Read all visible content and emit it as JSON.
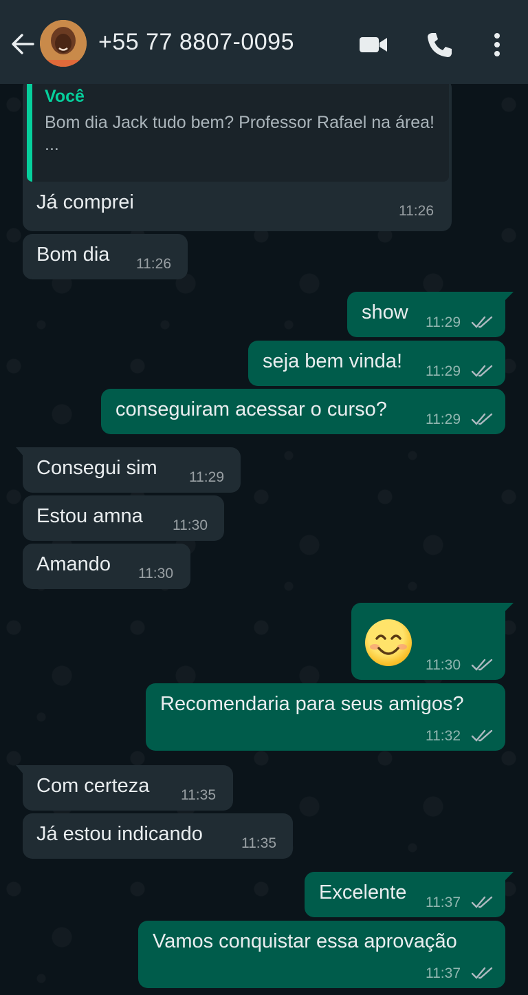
{
  "header": {
    "contact_name": "+55 77 8807-0095",
    "icons": [
      "back-arrow-icon",
      "video-call-icon",
      "phone-icon",
      "more-options-icon"
    ]
  },
  "messages": [
    {
      "side": "in",
      "quote_author": "Você",
      "quote_text": "Bom dia Jack tudo bem? Professor Rafael na área!",
      "quote_more": "...",
      "text": "Já comprei",
      "time": "11:26"
    },
    {
      "side": "in",
      "text": "Bom dia",
      "time": "11:26"
    },
    {
      "side": "out",
      "text": "show",
      "time": "11:29",
      "status": "read-ticks"
    },
    {
      "side": "out",
      "text": "seja bem vinda!",
      "time": "11:29",
      "status": "read-ticks"
    },
    {
      "side": "out",
      "text": "conseguiram acessar o curso?",
      "time": "11:29",
      "status": "read-ticks"
    },
    {
      "side": "in",
      "text": "Consegui sim",
      "time": "11:29"
    },
    {
      "side": "in",
      "text": "Estou amna",
      "time": "11:30"
    },
    {
      "side": "in",
      "text": "Amando",
      "time": "11:30"
    },
    {
      "side": "out",
      "emoji": "smiling-face-emoji",
      "time": "11:30",
      "status": "read-ticks"
    },
    {
      "side": "out",
      "text": "Recomendaria para seus amigos?",
      "time": "11:32",
      "status": "read-ticks"
    },
    {
      "side": "in",
      "text": "Com certeza",
      "time": "11:35"
    },
    {
      "side": "in",
      "text": "Já estou indicando",
      "time": "11:35"
    },
    {
      "side": "out",
      "text": "Excelente",
      "time": "11:37",
      "status": "read-ticks"
    },
    {
      "side": "out",
      "text": "Vamos conquistar essa aprovação",
      "time": "11:37",
      "status": "read-ticks"
    }
  ],
  "colors": {
    "header_bg": "#1f2c34",
    "chat_bg": "#0b141a",
    "incoming_bubble": "#202c33",
    "outgoing_bubble": "#005c4b",
    "quote_accent": "#06cf9c",
    "read_ticks": "#8696a0"
  }
}
